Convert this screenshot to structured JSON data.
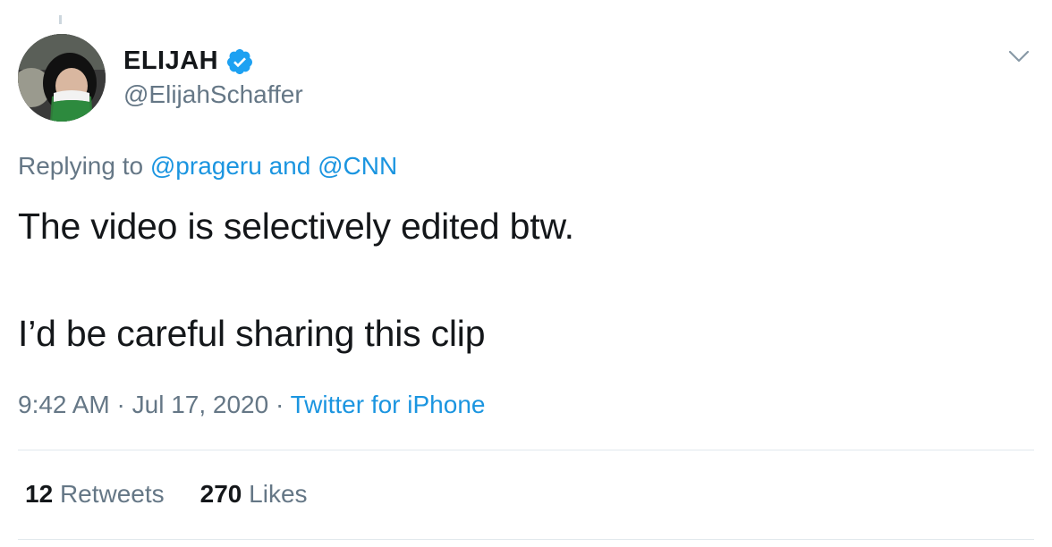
{
  "tweet": {
    "display_name": "ELIJAH",
    "handle": "@ElijahSchaffer",
    "verified_icon": "verified-badge-icon",
    "menu_icon": "chevron-down-icon",
    "replying_prefix": "Replying to",
    "replying_user1": "@prageru",
    "replying_and": "and",
    "replying_user2": "@CNN",
    "text_line1": "The video is selectively edited btw.",
    "text_line2": "I’d be careful sharing this clip",
    "time": "9:42 AM",
    "separator": "·",
    "date": "Jul 17, 2020",
    "source": "Twitter for iPhone"
  },
  "stats": {
    "retweets_count": "12",
    "retweets_label": "Retweets",
    "likes_count": "270",
    "likes_label": "Likes"
  },
  "colors": {
    "link": "#1b95e0",
    "secondary_text": "#657786",
    "primary_text": "#14171a",
    "verified": "#1da1f2",
    "divider": "#e1e8ed"
  }
}
